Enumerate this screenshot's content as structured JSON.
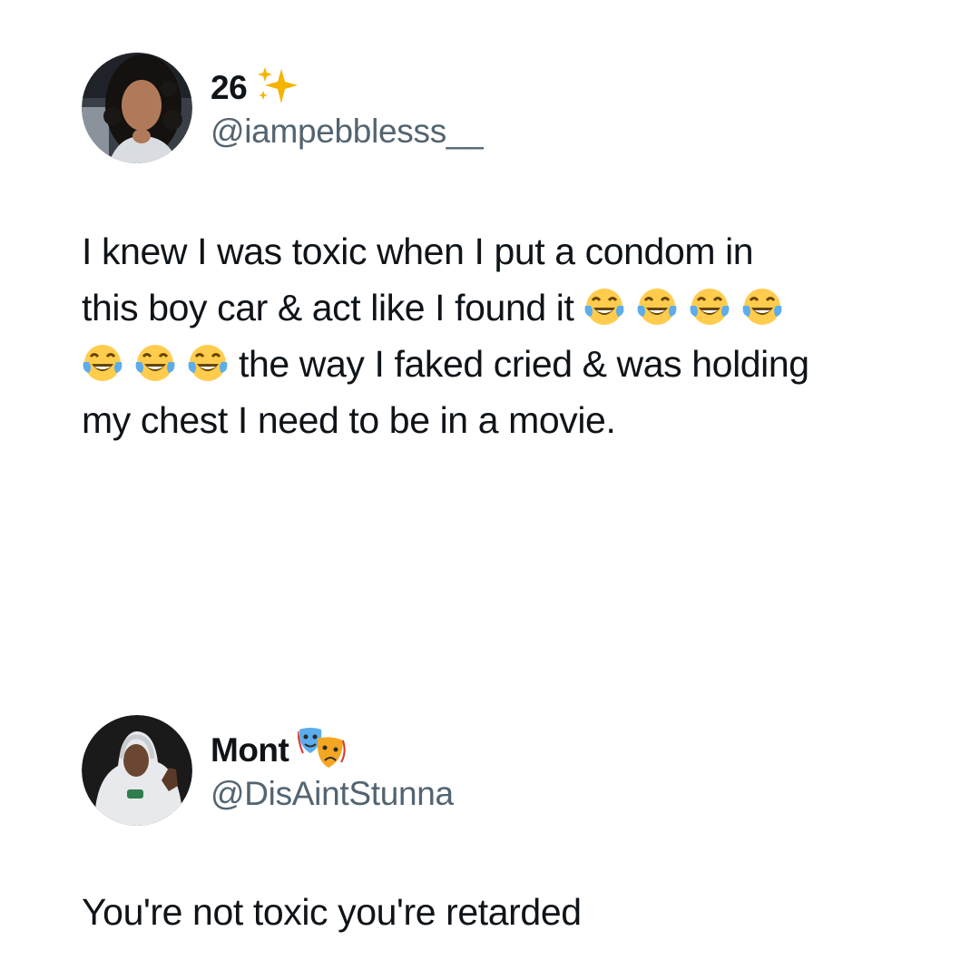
{
  "tweets": [
    {
      "display_name": "26",
      "display_name_emoji": "sparkles-icon",
      "handle": "@iampebblesss__",
      "text_line1": "I knew I was toxic when I put a condom in",
      "text_line2_prefix": "this boy car & act like I found it",
      "text_line3_suffix": "the way I faked cried & was holding",
      "text_line4": "my chest I need to be in a movie.",
      "emoji_run_1_count": 4,
      "emoji_run_2_count": 3,
      "emoji_name": "face-with-tears-of-joy-icon"
    },
    {
      "display_name": "Mont",
      "display_name_emoji": "performing-arts-icon",
      "handle": "@DisAintStunna",
      "text": "You're not toxic you're retarded"
    }
  ],
  "colors": {
    "text": "#0f1419",
    "handle": "#536471",
    "sparkle": "#f4b400",
    "emoji_face": "#ffcc4d",
    "emoji_tear": "#5dadec"
  }
}
